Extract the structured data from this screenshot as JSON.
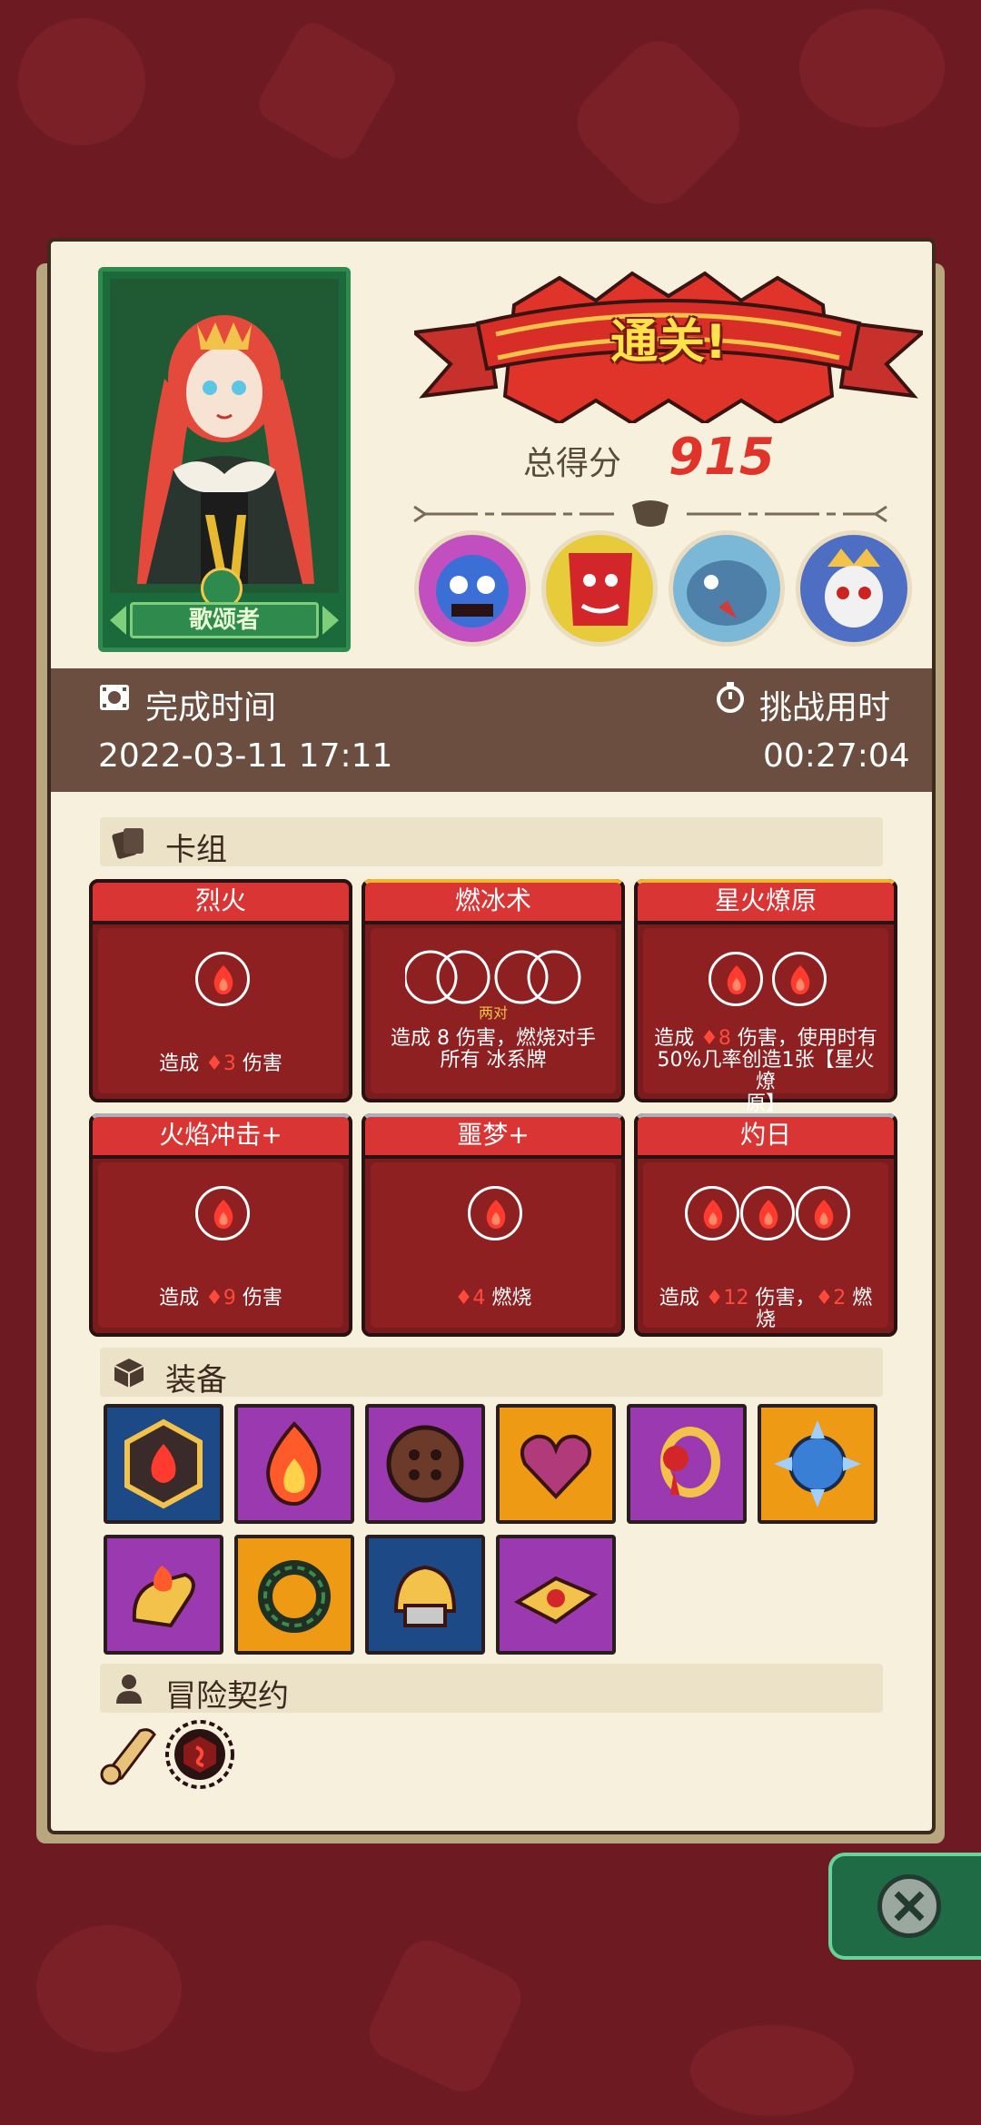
{
  "hero": {
    "name": "歌颂者"
  },
  "result": {
    "banner": "通关!",
    "score_label": "总得分",
    "score_value": "915"
  },
  "time": {
    "finish_label": "完成时间",
    "finish_value": "2022-03-11 17:11",
    "challenge_label": "挑战用时",
    "challenge_value": "00:27:04"
  },
  "deck": {
    "title": "卡组",
    "cards": [
      {
        "name": "烈火",
        "desc_pre": "造成 ",
        "num": "3",
        "desc_post": " 伤害"
      },
      {
        "name": "燃冰术",
        "pair_label": "两对",
        "desc_line1": "造成 8 伤害，燃烧对手",
        "desc_line2": "所有 冰系牌"
      },
      {
        "name": "星火燎原",
        "desc_pre": "造成 ",
        "num": "8",
        "desc_post": " 伤害，使用时有",
        "desc_line2": "50%几率创造1张【星火燎",
        "desc_line3": "原】"
      },
      {
        "name": "火焰冲击+",
        "desc_pre": "造成 ",
        "num": "9",
        "desc_post": " 伤害"
      },
      {
        "name": "噩梦+",
        "num": "4",
        "desc_post": " 燃烧"
      },
      {
        "name": "灼日",
        "desc_pre": "造成 ",
        "num": "12",
        "desc_mid": " 伤害，",
        "num2": "2",
        "desc_post": " 燃烧"
      }
    ]
  },
  "equipment": {
    "title": "装备"
  },
  "contract": {
    "title": "冒险契约"
  },
  "colors": {
    "paper": "#f7f0dc",
    "card_red": "#d93535",
    "score_red": "#e0332a",
    "band": "#6b4e3f"
  }
}
